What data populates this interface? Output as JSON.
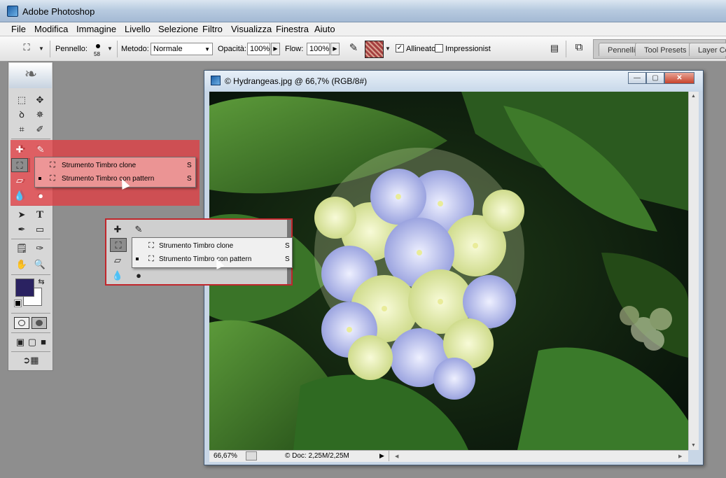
{
  "app": {
    "title": "Adobe Photoshop"
  },
  "menu": [
    "File",
    "Modifica",
    "Immagine",
    "Livello",
    "Selezione",
    "Filtro",
    "Visualizza",
    "Finestra",
    "Aiuto"
  ],
  "options": {
    "brush_label": "Pennello:",
    "brush_size": "58",
    "mode_label": "Metodo:",
    "mode_value": "Normale",
    "opacity_label": "Opacità:",
    "opacity_value": "100%",
    "flow_label": "Flow:",
    "flow_value": "100%",
    "aligned_label": "Allineato",
    "aligned_checked": true,
    "impressionist_label": "Impressionist",
    "impressionist_checked": false
  },
  "panel_tabs": [
    "Pennelli",
    "Tool Presets",
    "Layer Co"
  ],
  "flyout": {
    "items": [
      {
        "label": "Strumento Timbro clone",
        "key": "S",
        "selected": false
      },
      {
        "label": "Strumento Timbro con pattern",
        "key": "S",
        "selected": true
      }
    ]
  },
  "document": {
    "title": "© Hydrangeas.jpg @ 66,7% (RGB/8#)",
    "zoom": "66,67%",
    "doc_info": "© Doc: 2,25M/2,25M"
  },
  "colors": {
    "foreground": "#2a2261",
    "background": "#ffffff",
    "highlight": "#e03e42"
  },
  "icons": [
    "feather-icon",
    "marquee-icon",
    "move-icon",
    "lasso-icon",
    "magic-wand-icon",
    "crop-icon",
    "slice-icon",
    "healing-brush-icon",
    "brush-icon",
    "clone-stamp-icon",
    "history-brush-icon",
    "eraser-icon",
    "gradient-icon",
    "blur-icon",
    "dodge-icon",
    "path-selection-icon",
    "type-icon",
    "pen-icon",
    "shape-icon",
    "notes-icon",
    "eyedropper-icon",
    "hand-icon",
    "zoom-icon",
    "swap-colors-icon",
    "default-colors-icon",
    "standard-mode-icon",
    "quickmask-mode-icon",
    "screen-mode-icon",
    "jump-to-imageready-icon"
  ]
}
